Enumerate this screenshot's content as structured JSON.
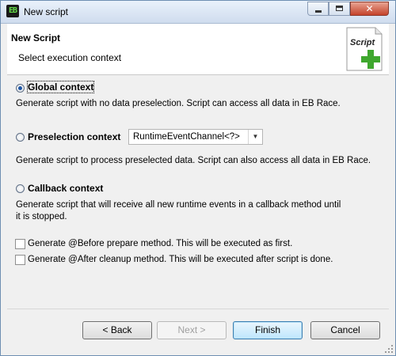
{
  "window": {
    "title": "New script",
    "app_icon_text": "EB"
  },
  "header": {
    "title": "New Script",
    "subtitle": "Select execution context",
    "icon_text": "Script"
  },
  "options": {
    "global": {
      "label": "Global context",
      "description": "Generate script with no data preselection. Script can access all data in EB Race."
    },
    "preselection": {
      "label": "Preselection context",
      "combo_value": "RuntimeEventChannel<?>",
      "description": "Generate script to process preselected data. Script can also access all data in EB Race."
    },
    "callback": {
      "label": "Callback context",
      "description_line1": "Generate script that will receive all new runtime events in a callback method until",
      "description_line2": "it is stopped."
    },
    "before": {
      "label": "Generate @Before prepare method. This will be executed as first."
    },
    "after": {
      "label": "Generate @After cleanup method. This will be executed after script is done."
    }
  },
  "buttons": {
    "back": "< Back",
    "next": "Next >",
    "finish": "Finish",
    "cancel": "Cancel"
  },
  "colors": {
    "titlebar": "#cfdcee",
    "close_button": "#c4422a",
    "accent_green": "#3fa72e"
  }
}
